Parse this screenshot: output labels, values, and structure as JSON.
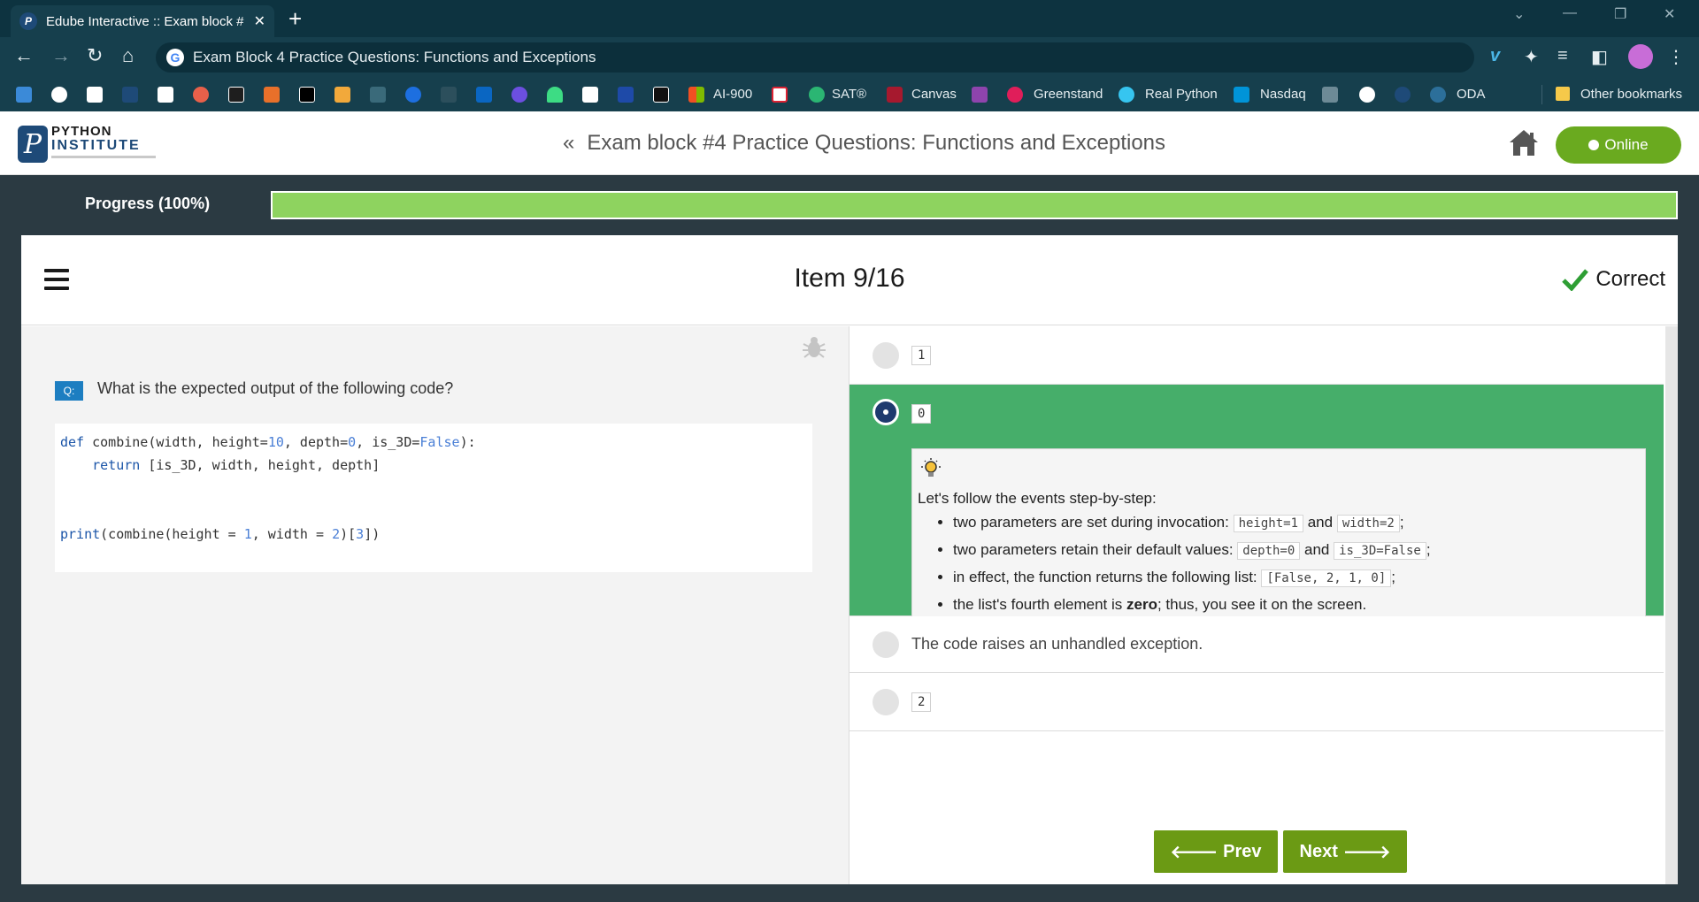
{
  "browser": {
    "tab_title": "Edube Interactive :: Exam block #",
    "tab_favicon": "P",
    "new_tab": "+",
    "address": "Exam Block 4 Practice Questions: Functions and Exceptions",
    "bookmarks": [
      "AI-900",
      "SAT®",
      "Canvas",
      "Greenstand",
      "Real Python",
      "Nasdaq",
      "ODA",
      "Other bookmarks"
    ]
  },
  "site": {
    "logo_line1": "PYTHON",
    "logo_line2": "INSTITUTE",
    "logo_glyph": "P",
    "back_glyph": "«",
    "title": "Exam block #4 Practice Questions: Functions and Exceptions",
    "online_label": "Online"
  },
  "progress": {
    "label": "Progress (100%)",
    "value": 1.0
  },
  "card": {
    "item_label": "Item 9/16",
    "status_label": "Correct",
    "question_badge": "Q:",
    "question": "What is the expected output of the following code?",
    "code": {
      "l1_def": "def",
      "l1_a": " combine(width, height=",
      "l1_n1": "10",
      "l1_b": ", depth=",
      "l1_n2": "0",
      "l1_c": ", is_3D=",
      "l1_bool": "False",
      "l1_d": "):",
      "l2_ret": "    return",
      "l2_rest": " [is_3D, width, height, depth]",
      "l5_print": "print",
      "l5_a": "(combine(height = ",
      "l5_n1": "1",
      "l5_b": ", width = ",
      "l5_n2": "2",
      "l5_c": ")[",
      "l5_n3": "3",
      "l5_d": "])"
    },
    "options": [
      {
        "label": "1"
      },
      {
        "label": "0"
      },
      {
        "label": "The code raises an unhandled exception."
      },
      {
        "label": "2"
      }
    ],
    "explanation": {
      "intro": "Let's follow the events step-by-step:",
      "b1_text": "two parameters are set during invocation: ",
      "b1_c1": "height=1",
      "b1_and": " and ",
      "b1_c2": "width=2",
      "b1_end": ";",
      "b2_text": "two parameters retain their default values: ",
      "b2_c1": "depth=0",
      "b2_and": " and ",
      "b2_c2": "is_3D=False",
      "b2_end": ";",
      "b3_text": "in effect, the function returns the following list: ",
      "b3_c1": "[False, 2, 1, 0]",
      "b3_end": ";",
      "b4_a": "the list's fourth element is ",
      "b4_bold": "zero",
      "b4_b": "; thus, you see it on the screen."
    },
    "prev_label": "Prev",
    "next_label": "Next"
  },
  "colors": {
    "selected_option": "#46ae6a",
    "progress_fill": "#8ed35f",
    "online": "#6aaa1f",
    "nav_button": "#6b9a14",
    "check": "#2e9e34"
  }
}
